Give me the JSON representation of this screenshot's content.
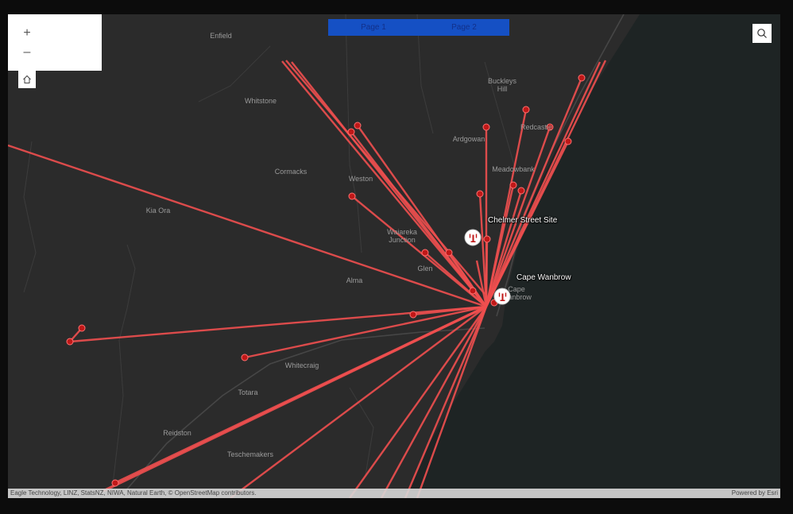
{
  "map": {
    "controls": {
      "zoom_in_label": "+",
      "zoom_out_label": "–"
    },
    "page_tabs": [
      "Page 1",
      "Page 2"
    ],
    "attribution": "Eagle Technology, LINZ, StatsNZ, NIWA, Natural Earth, © OpenStreetMap contributors.",
    "powered_by": "Powered by Esri",
    "places": {
      "enfield": "Enfield",
      "whitstone": "Whitstone",
      "buckleys_hill": "Buckleys Hill",
      "redcastle": "Redcastle",
      "ardgowan": "Ardgowan",
      "meadowbank": "Meadowbank",
      "cormacks": "Cormacks",
      "weston": "Weston",
      "kia_ora": "Kia Ora",
      "waiareka_junction": "Waiareka Junction",
      "glen": "Glen",
      "alma": "Alma",
      "whitecraig": "Whitecraig",
      "totara": "Totara",
      "reidston": "Reidston",
      "teschemakers": "Teschemakers",
      "cape_wanbrow_town": "Cape Wanbrow"
    },
    "sites": {
      "chelmer_street": "Chelmer Street Site",
      "cape_wanbrow": "Cape Wanbrow"
    },
    "colors": {
      "background": "#2b2b2b",
      "sea": "#1e2424",
      "line": "#ef4f4f",
      "point": "#c01818",
      "tabs": "#1550c4"
    },
    "icons": [
      "zoom-in-icon",
      "zoom-out-icon",
      "home-icon",
      "search-icon",
      "antenna-icon"
    ]
  }
}
